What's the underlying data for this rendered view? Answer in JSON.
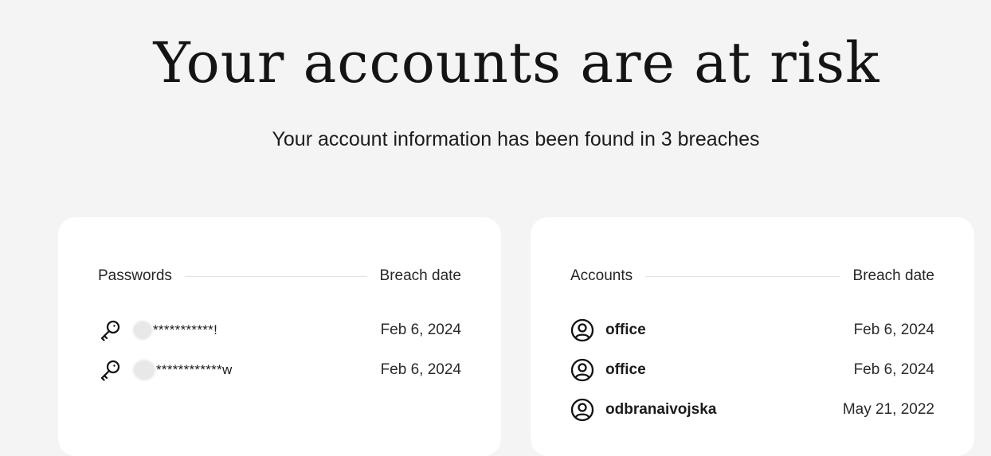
{
  "hero": {
    "title": "Your accounts are at risk",
    "subtitle": "Your account information has been found in 3 breaches"
  },
  "passwords_card": {
    "heading": "Passwords",
    "date_heading": "Breach date",
    "rows": [
      {
        "icon": "key-icon",
        "masked": "***********!",
        "date": "Feb 6, 2024"
      },
      {
        "icon": "key-icon",
        "masked": "************w",
        "date": "Feb 6, 2024"
      }
    ]
  },
  "accounts_card": {
    "heading": "Accounts",
    "date_heading": "Breach date",
    "rows": [
      {
        "icon": "user-circle-icon",
        "name": "office",
        "date": "Feb 6, 2024"
      },
      {
        "icon": "user-circle-icon",
        "name": "office",
        "date": "Feb 6, 2024"
      },
      {
        "icon": "user-circle-icon",
        "name": "odbranaivojska",
        "date": "May 21, 2022"
      }
    ]
  }
}
